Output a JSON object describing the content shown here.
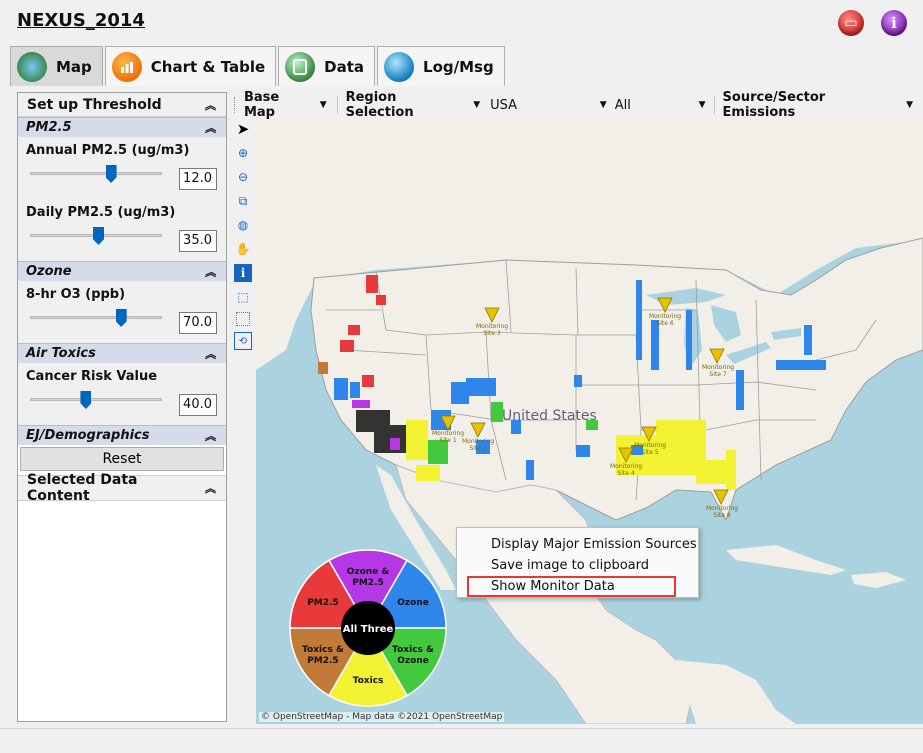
{
  "app": {
    "title": "NEXUS_2014"
  },
  "tabs": [
    {
      "label": "Map",
      "active": true
    },
    {
      "label": "Chart & Table",
      "active": false
    },
    {
      "label": "Data",
      "active": false
    },
    {
      "label": "Log/Msg",
      "active": false
    }
  ],
  "left_panel": {
    "header": "Set up Threshold",
    "sections": {
      "pm25": {
        "title": "PM2.5",
        "annual": {
          "label": "Annual PM2.5 (ug/m3)",
          "value": "12.0",
          "slider_fraction": 0.6
        },
        "daily": {
          "label": "Daily PM2.5 (ug/m3)",
          "value": "35.0",
          "slider_fraction": 0.5
        }
      },
      "ozone": {
        "title": "Ozone",
        "o3": {
          "label": "8-hr O3 (ppb)",
          "value": "70.0",
          "slider_fraction": 0.68
        }
      },
      "air_toxics": {
        "title": "Air Toxics",
        "cancer": {
          "label": "Cancer Risk Value",
          "value": "40.0",
          "slider_fraction": 0.4
        }
      },
      "ej": {
        "title": "EJ/Demographics"
      }
    },
    "reset_label": "Reset",
    "selected_header": "Selected Data Content"
  },
  "map_toolbar": {
    "base_map": "Base Map",
    "region_selection": "Region Selection",
    "region_value": "USA",
    "sub_region_value": "All",
    "source_sector": "Source/Sector Emissions"
  },
  "map": {
    "country_label": "United States",
    "monitoring_sites": [
      {
        "label_line1": "Monitoring",
        "label_line2": "Site 1"
      },
      {
        "label_line1": "Monitoring",
        "label_line2": "Site 2"
      },
      {
        "label_line1": "Monitoring",
        "label_line2": "Site 3"
      },
      {
        "label_line1": "Monitoring",
        "label_line2": "Site 4"
      },
      {
        "label_line1": "Monitoring",
        "label_line2": "Site 5"
      },
      {
        "label_line1": "Monitoring",
        "label_line2": "Site 6"
      },
      {
        "label_line1": "Monitoring",
        "label_line2": "Site 7"
      },
      {
        "label_line1": "Monitoring",
        "label_line2": "Site 8"
      }
    ],
    "attribution": "© OpenStreetMap - Map data ©2021 OpenStreetMap"
  },
  "context_menu": {
    "items": [
      {
        "label": "Display Major Emission Sources",
        "highlighted": false
      },
      {
        "label": "Save image to clipboard",
        "highlighted": false
      },
      {
        "label": "Show Monitor Data",
        "highlighted": true
      }
    ]
  },
  "legend_wheel": {
    "center": "All Three",
    "segments": [
      {
        "label1": "Ozone &",
        "label2": "PM2.5",
        "color": "#b537e6"
      },
      {
        "label1": "Ozone",
        "label2": "",
        "color": "#2f86ea"
      },
      {
        "label1": "Toxics &",
        "label2": "Ozone",
        "color": "#43c93e"
      },
      {
        "label1": "Toxics",
        "label2": "",
        "color": "#f2f233"
      },
      {
        "label1": "Toxics &",
        "label2": "PM2.5",
        "color": "#c17a37"
      },
      {
        "label1": "PM2.5",
        "label2": "",
        "color": "#e83a3a"
      }
    ]
  },
  "colors": {
    "pm25": "#e83a3a",
    "ozone": "#2f86ea",
    "toxics": "#f2f233",
    "ozone_pm25": "#b537e6",
    "toxics_ozone": "#43c93e",
    "toxics_pm25": "#c17a37",
    "all_three": "#333333",
    "water": "#aad3df",
    "land": "#f2efe9"
  }
}
